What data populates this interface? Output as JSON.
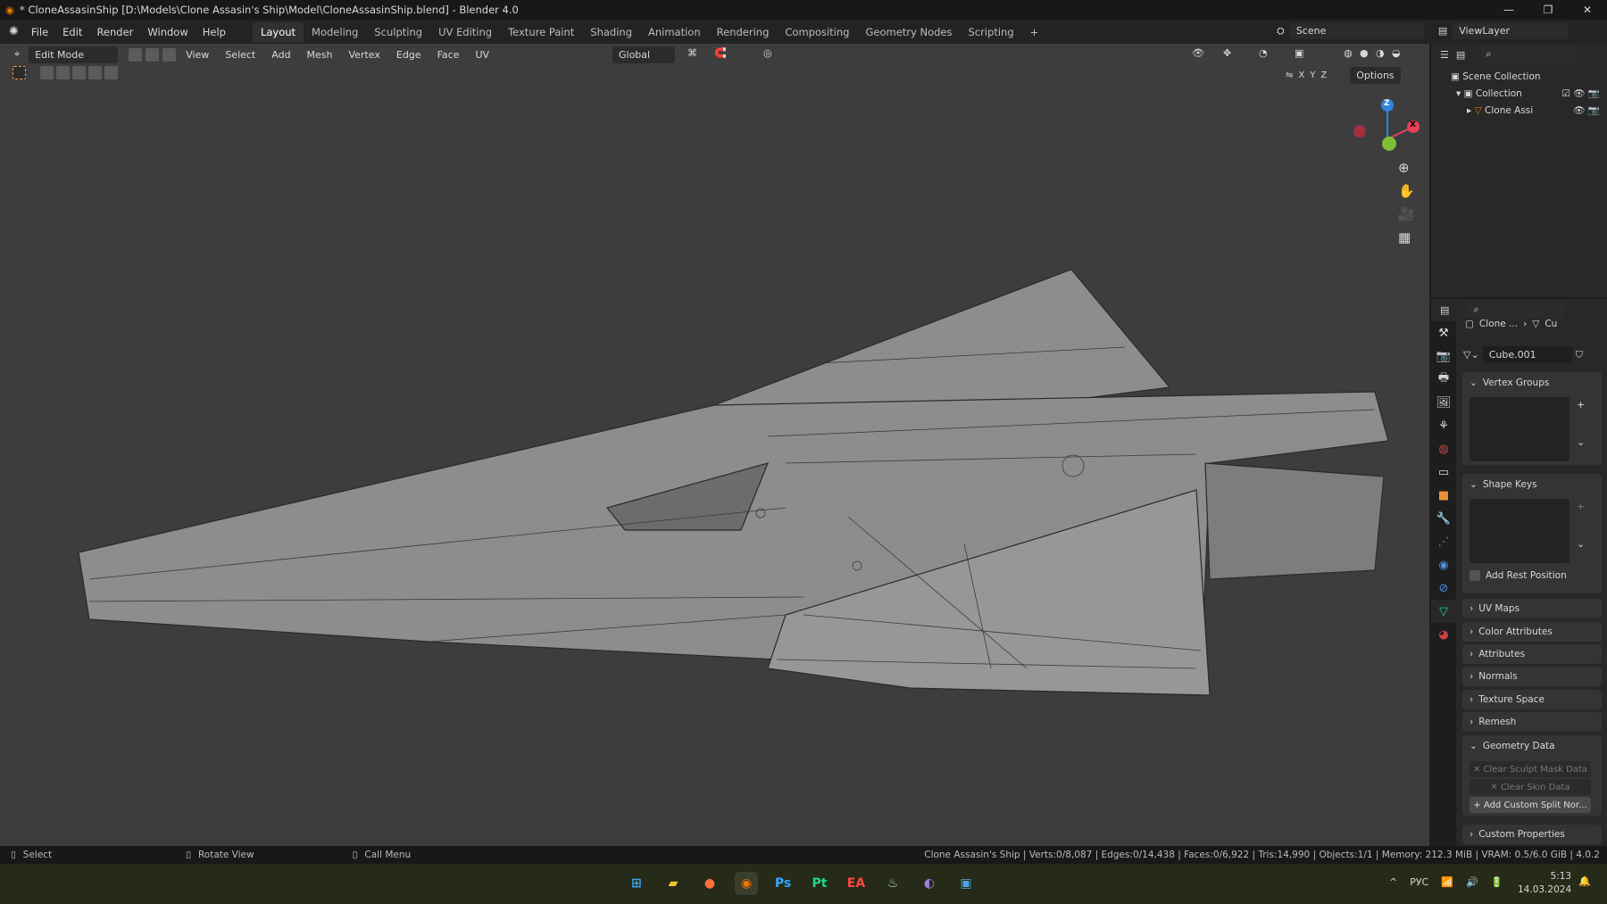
{
  "window": {
    "title": "* CloneAssasinShip [D:\\Models\\Clone Assasin's Ship\\Model\\CloneAssasinShip.blend] - Blender 4.0",
    "min": "—",
    "max": "❐",
    "close": "✕"
  },
  "menu": [
    "File",
    "Edit",
    "Render",
    "Window",
    "Help"
  ],
  "workspaces": [
    "Layout",
    "Modeling",
    "Sculpting",
    "UV Editing",
    "Texture Paint",
    "Shading",
    "Animation",
    "Rendering",
    "Compositing",
    "Geometry Nodes",
    "Scripting",
    "+"
  ],
  "scene": {
    "label": "Scene",
    "viewlayer": "ViewLayer"
  },
  "viewport_header": {
    "mode": "Edit Mode",
    "menus": [
      "View",
      "Select",
      "Add",
      "Mesh",
      "Vertex",
      "Edge",
      "Face",
      "UV"
    ],
    "orientation": "Global",
    "options": "Options",
    "axes": [
      "X",
      "Y",
      "Z"
    ]
  },
  "gizmo": {
    "z": "Z",
    "x": "X"
  },
  "outliner": {
    "scene_collection": "Scene Collection",
    "collection": "Collection",
    "object": "Clone Assi"
  },
  "properties": {
    "breadcrumb_obj": "Clone ...",
    "breadcrumb_mesh": "Cu",
    "mesh_name": "Cube.001",
    "vertex_groups": "Vertex Groups",
    "shape_keys": "Shape Keys",
    "add_rest_position": "Add Rest Position",
    "collapsed": [
      "UV Maps",
      "Color Attributes",
      "Attributes",
      "Normals",
      "Texture Space",
      "Remesh"
    ],
    "geometry_data": "Geometry Data",
    "clear_sculpt": "Clear Sculpt Mask Data",
    "clear_skin": "Clear Skin Data",
    "add_split": "Add Custom Split Nor...",
    "custom_properties": "Custom Properties"
  },
  "status": {
    "select": "Select",
    "rotate": "Rotate View",
    "call_menu": "Call Menu",
    "stats": "Clone Assasin's Ship | Verts:0/8,087 | Edges:0/14,438 | Faces:0/6,922 | Tris:14,990 | Objects:1/1 | Memory: 212.3 MiB | VRAM: 0.5/6.0 GiB | 4.0.2"
  },
  "taskbar": {
    "lang": "РУС",
    "time": "5:13",
    "date": "14.03.2024",
    "apps": [
      {
        "name": "windows-start",
        "glyph": "⊞",
        "color": "#3fa9f5"
      },
      {
        "name": "file-explorer",
        "glyph": "▰",
        "color": "#f4c430"
      },
      {
        "name": "firefox",
        "glyph": "●",
        "color": "#ff7139"
      },
      {
        "name": "blender",
        "glyph": "◉",
        "color": "#ea7600"
      },
      {
        "name": "photoshop",
        "glyph": "Ps",
        "color": "#31a8ff"
      },
      {
        "name": "pycharm",
        "glyph": "Pt",
        "color": "#21d789"
      },
      {
        "name": "ea-app",
        "glyph": "EA",
        "color": "#ff4747"
      },
      {
        "name": "steam",
        "glyph": "♨",
        "color": "#c7d5e0"
      },
      {
        "name": "tor-browser",
        "glyph": "◐",
        "color": "#9d7fe0"
      },
      {
        "name": "messenger",
        "glyph": "▣",
        "color": "#4aa3df"
      }
    ]
  },
  "colors": {
    "accent": "#4772b3",
    "viewport_bg": "#3d3d3d",
    "mesh": "#8a8a8a",
    "x_axis": "#e8415b",
    "y_axis": "#7fbf34",
    "z_axis": "#2e86de"
  }
}
